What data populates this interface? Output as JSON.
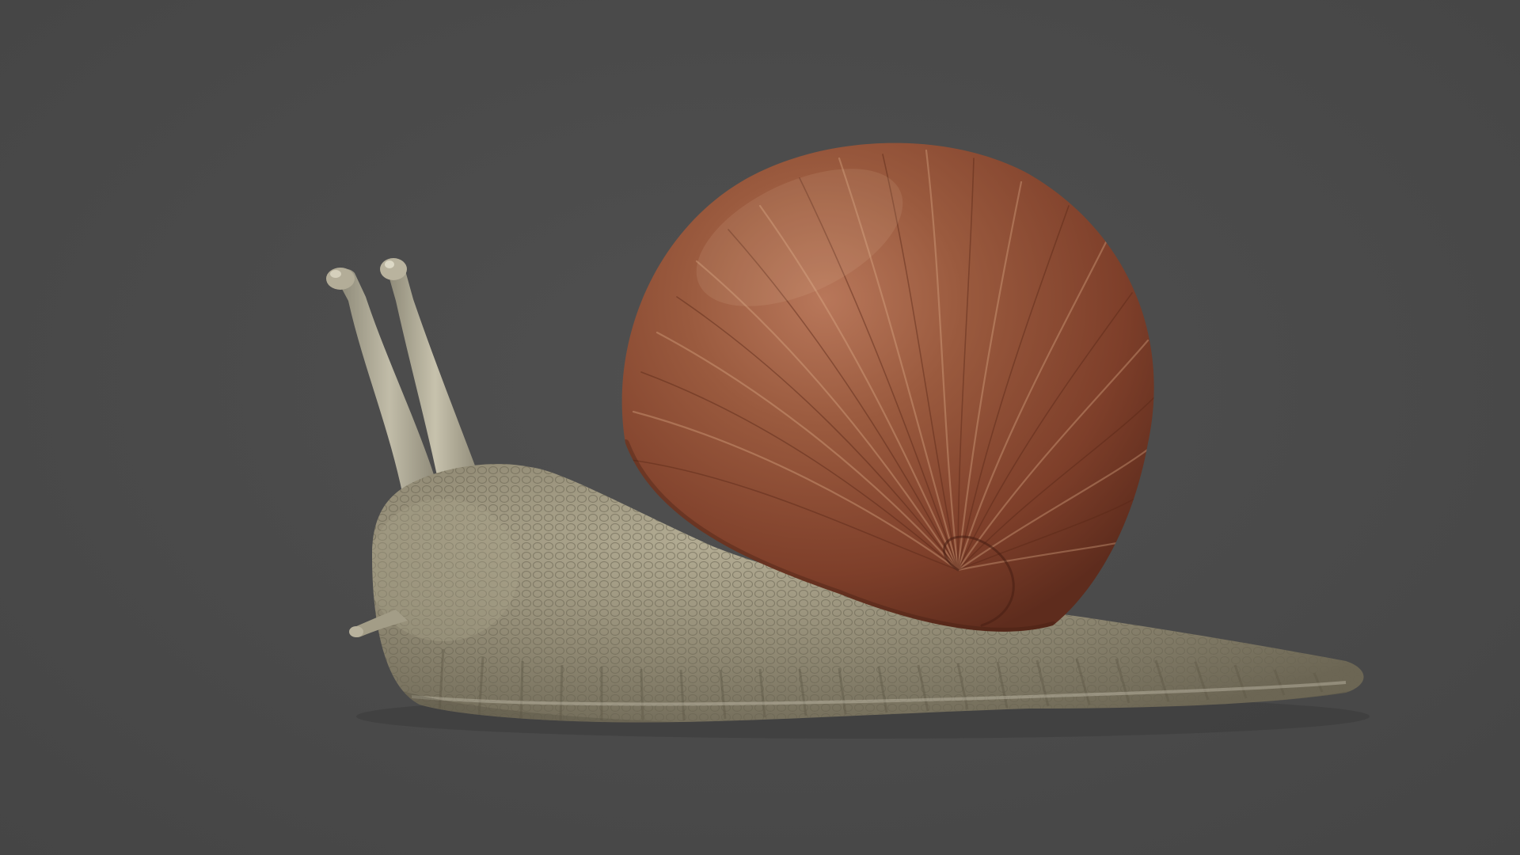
{
  "scene": {
    "subject_icon": "snail-icon",
    "colors": {
      "background": "#4a4a4a",
      "shell": "#8a4a32",
      "shell_highlight": "#c98a62",
      "body": "#8c8672",
      "body_highlight": "#b9b29a"
    }
  }
}
